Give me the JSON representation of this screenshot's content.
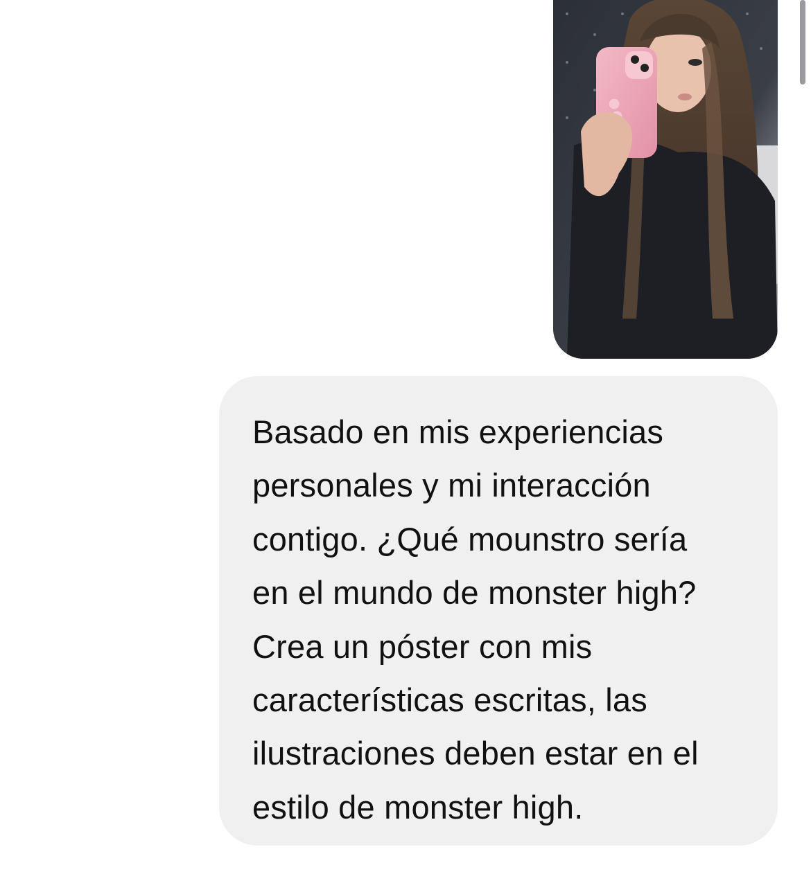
{
  "conversation": {
    "attachment": {
      "type": "photo",
      "icon": "mirror-selfie-photo"
    },
    "message": {
      "lines": [
        "Basado en mis experiencias",
        "personales y mi interacción",
        "contigo. ¿Qué mounstro sería",
        "en el mundo de monster high?",
        "Crea un póster con mis",
        "características escritas, las",
        "ilustraciones deben estar en el",
        "estilo de monster high."
      ]
    }
  },
  "colors": {
    "bubble_background": "#f0f0f0",
    "text": "#111111",
    "scrollbar": "#8e8e93"
  }
}
